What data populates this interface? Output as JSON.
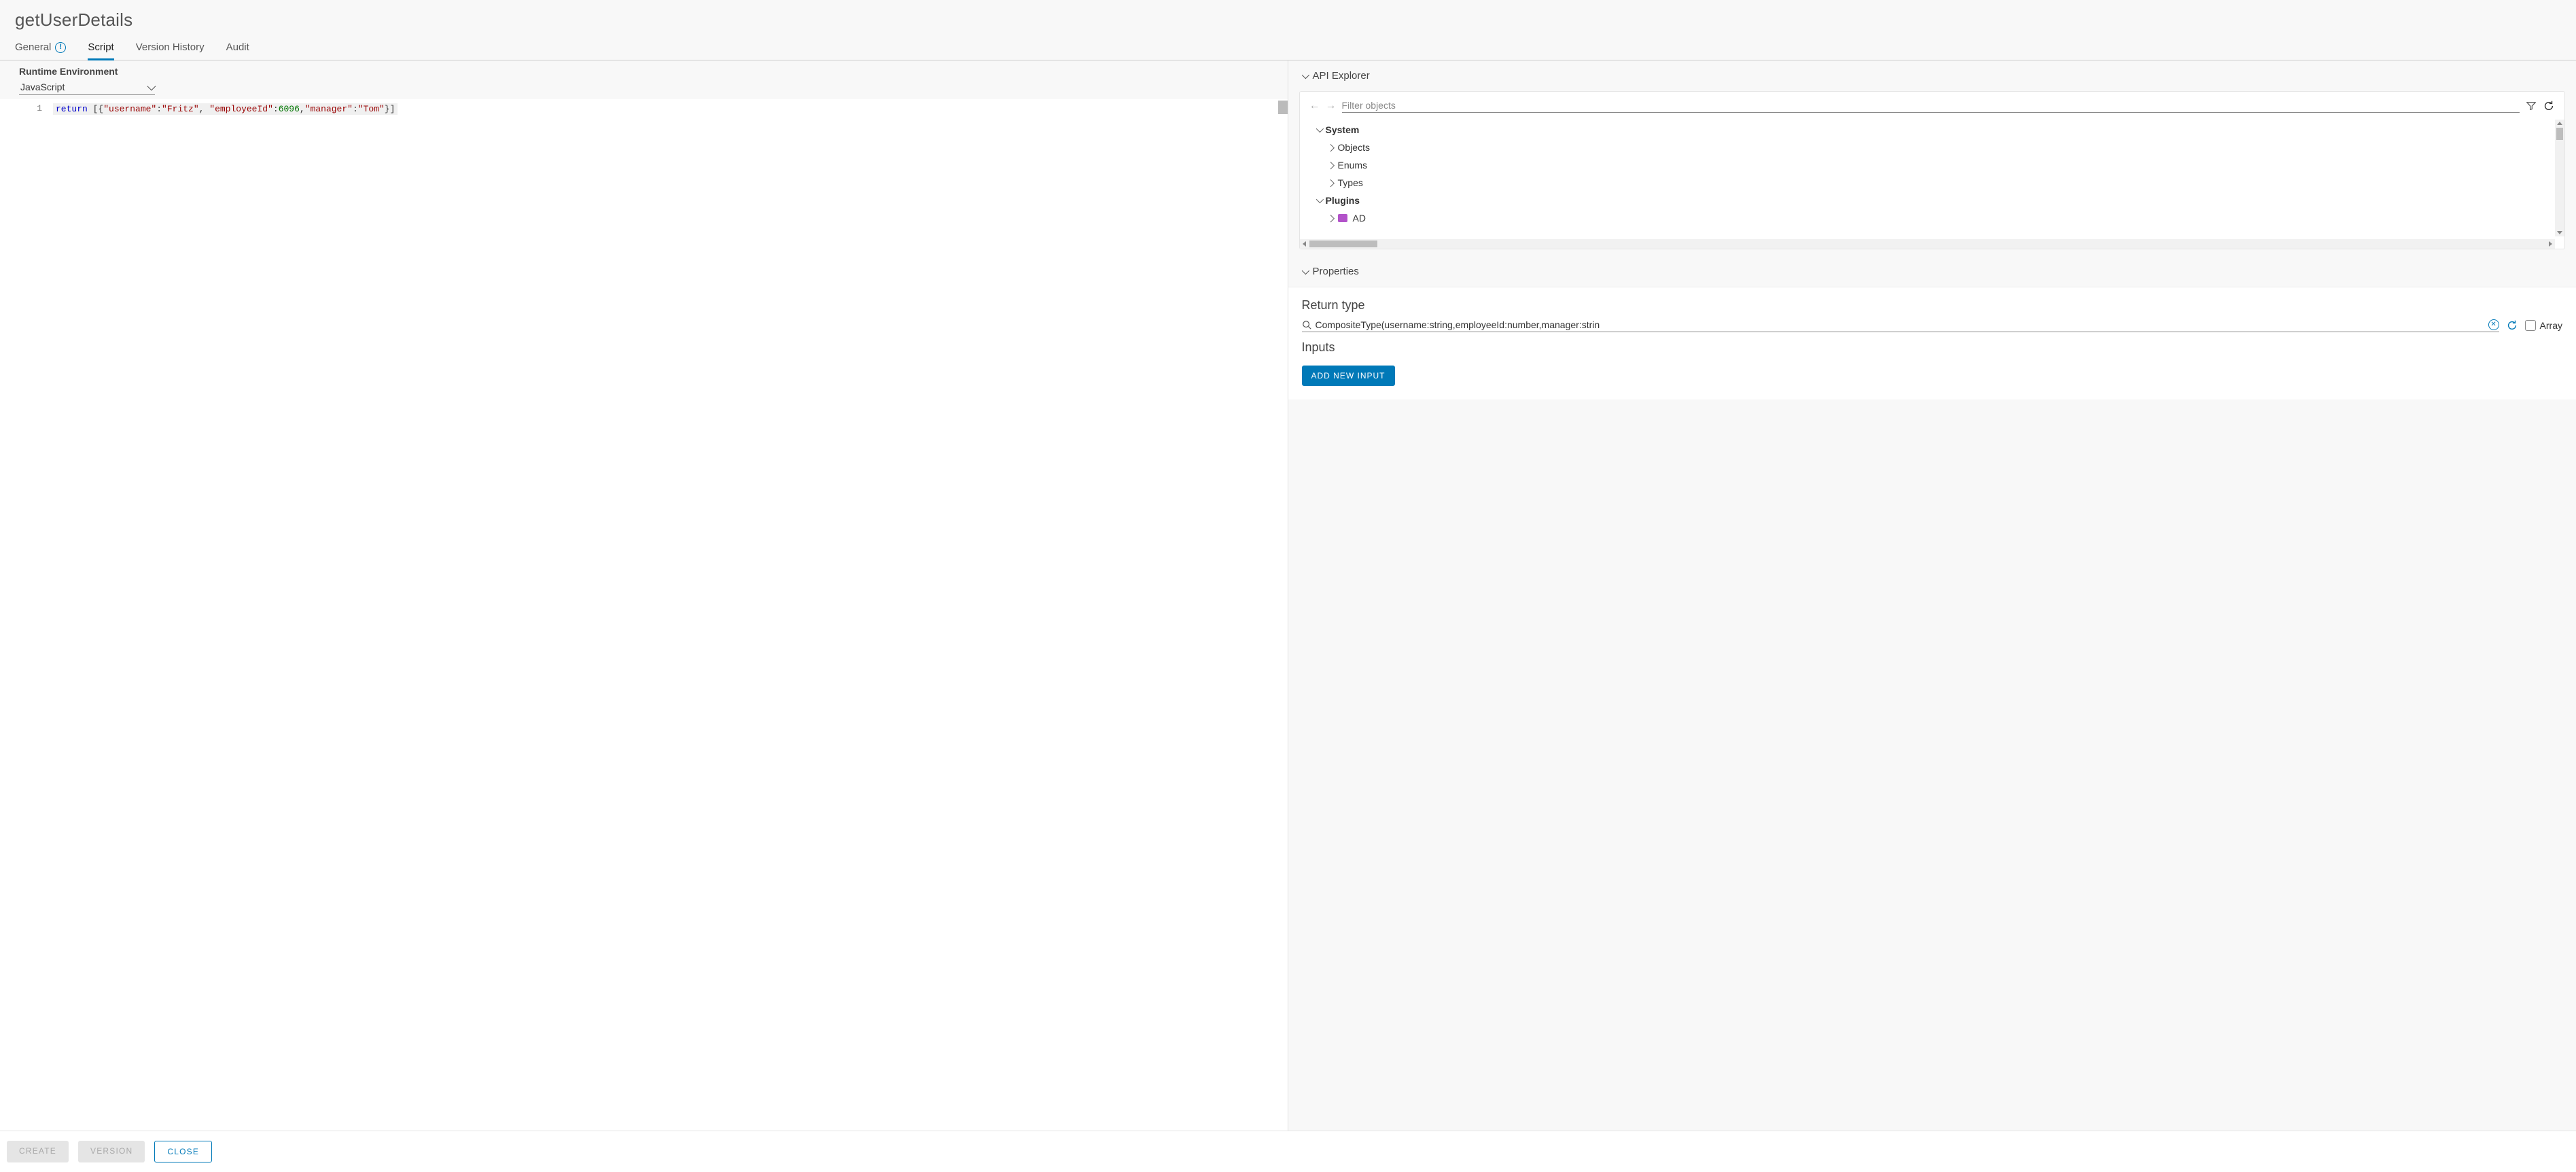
{
  "header": {
    "title": "getUserDetails"
  },
  "tabs": [
    {
      "id": "general",
      "label": "General",
      "has_info": true,
      "active": false
    },
    {
      "id": "script",
      "label": "Script",
      "has_info": false,
      "active": true
    },
    {
      "id": "version",
      "label": "Version History",
      "has_info": false,
      "active": false
    },
    {
      "id": "audit",
      "label": "Audit",
      "has_info": false,
      "active": false
    }
  ],
  "runtime": {
    "label": "Runtime Environment",
    "value": "JavaScript"
  },
  "editor": {
    "lines": [
      {
        "num": "1",
        "tokens": [
          {
            "t": "return",
            "c": "kw"
          },
          {
            "t": " [{",
            "c": "punc"
          },
          {
            "t": "\"username\"",
            "c": "str"
          },
          {
            "t": ":",
            "c": "punc"
          },
          {
            "t": "\"Fritz\"",
            "c": "str"
          },
          {
            "t": ", ",
            "c": "punc"
          },
          {
            "t": "\"employeeId\"",
            "c": "str"
          },
          {
            "t": ":",
            "c": "punc"
          },
          {
            "t": "6096",
            "c": "num"
          },
          {
            "t": ",",
            "c": "punc"
          },
          {
            "t": "\"manager\"",
            "c": "str"
          },
          {
            "t": ":",
            "c": "punc"
          },
          {
            "t": "\"Tom\"",
            "c": "str"
          },
          {
            "t": "}]",
            "c": "punc"
          }
        ]
      }
    ]
  },
  "api_explorer": {
    "title": "API Explorer",
    "filter_placeholder": "Filter objects",
    "tree": [
      {
        "label": "System",
        "level": 0,
        "open": true,
        "bold": true
      },
      {
        "label": "Objects",
        "level": 1,
        "open": false,
        "bold": false
      },
      {
        "label": "Enums",
        "level": 1,
        "open": false,
        "bold": false
      },
      {
        "label": "Types",
        "level": 1,
        "open": false,
        "bold": false
      },
      {
        "label": "Plugins",
        "level": 0,
        "open": true,
        "bold": true
      },
      {
        "label": "AD",
        "level": 1,
        "open": false,
        "bold": false,
        "icon": "plugin"
      }
    ]
  },
  "properties": {
    "title": "Properties",
    "return_type_label": "Return type",
    "return_type_value": "CompositeType(username:string,employeeId:number,manager:strin",
    "array_label": "Array",
    "inputs_label": "Inputs",
    "add_button": "ADD NEW INPUT"
  },
  "footer": {
    "create": "CREATE",
    "version": "VERSION",
    "close": "CLOSE"
  }
}
